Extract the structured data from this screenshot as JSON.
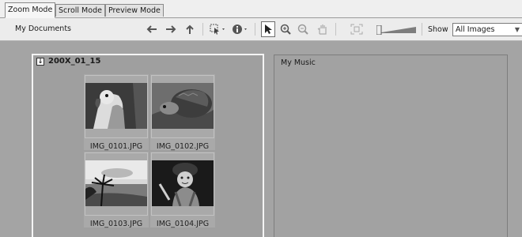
{
  "tabs": [
    {
      "label": "Zoom Mode",
      "active": true
    },
    {
      "label": "Scroll Mode",
      "active": false
    },
    {
      "label": "Preview Mode",
      "active": false
    }
  ],
  "toolbar": {
    "location": "My Documents",
    "icons": [
      "back-arrow-icon",
      "forward-arrow-icon",
      "up-arrow-icon",
      "select-dropdown-icon",
      "info-dropdown-icon",
      "pointer-icon",
      "zoom-in-icon",
      "zoom-out-icon",
      "hand-icon",
      "fit-icon",
      "zoom-slider"
    ],
    "show_label": "Show",
    "filter_value": "All Images"
  },
  "left_panel": {
    "title": "200X_01_15",
    "images": [
      {
        "filename": "IMG_0101.JPG",
        "subject": "parrot"
      },
      {
        "filename": "IMG_0102.JPG",
        "subject": "tortoise"
      },
      {
        "filename": "IMG_0103.JPG",
        "subject": "beach-sunset"
      },
      {
        "filename": "IMG_0104.JPG",
        "subject": "child-in-winter-clothes"
      }
    ]
  },
  "right_panel": {
    "title": "My Music"
  }
}
